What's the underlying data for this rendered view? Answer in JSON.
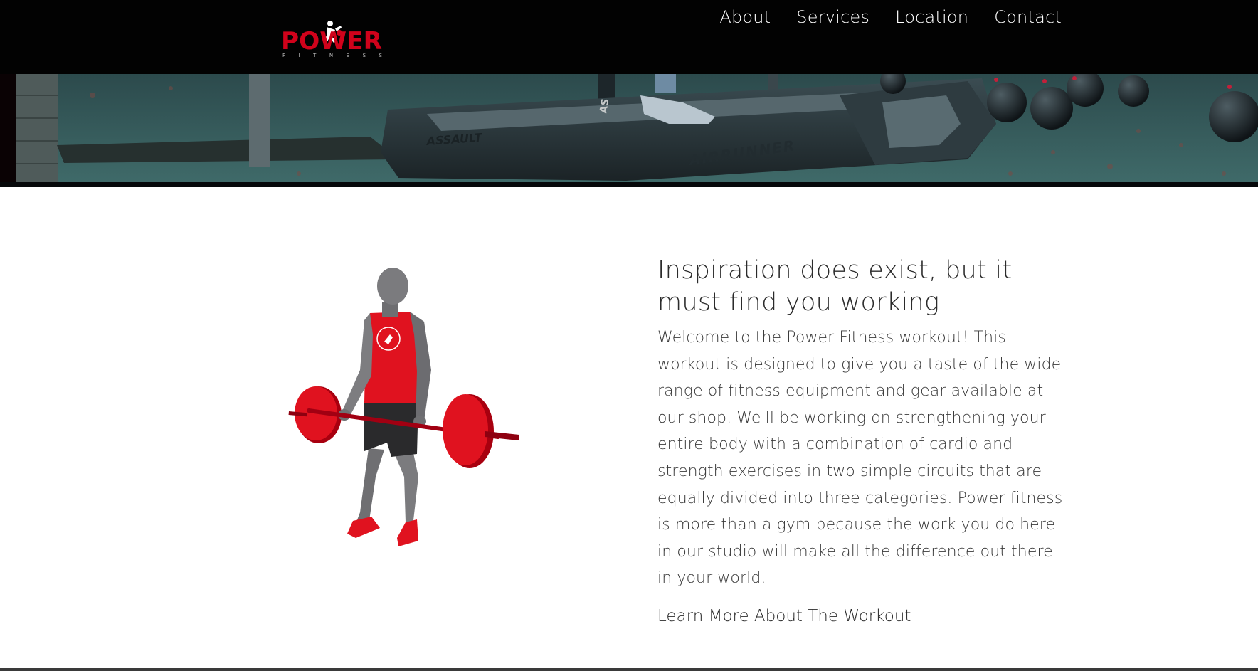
{
  "header": {
    "logo": {
      "wordmark": "POWER",
      "tagline": "FITNESS"
    },
    "nav": [
      {
        "label": "About"
      },
      {
        "label": "Services"
      },
      {
        "label": "Location"
      },
      {
        "label": "Contact"
      }
    ]
  },
  "hero": {
    "treadmill_brand": "ASSAULT",
    "treadmill_model": "AIRRUNNER",
    "equipment_mark": "AS"
  },
  "main": {
    "headline": "Inspiration does exist, but it must find you working",
    "body": "Welcome to the Power Fitness workout! This workout is designed to give you a taste of the wide range of fitness equipment and gear available at our shop. We'll be working on strengthening your entire body with a combination of cardio and strength exercises in two simple circuits that are equally divided into three categories. Power fitness is more than a gym because the work you do here in our studio will make all the difference out there in your world.",
    "cta_label": "Learn More About The Workout"
  },
  "colors": {
    "brand_red": "#d0021b",
    "header_bg": "#020202",
    "text": "#2b2b2b"
  }
}
